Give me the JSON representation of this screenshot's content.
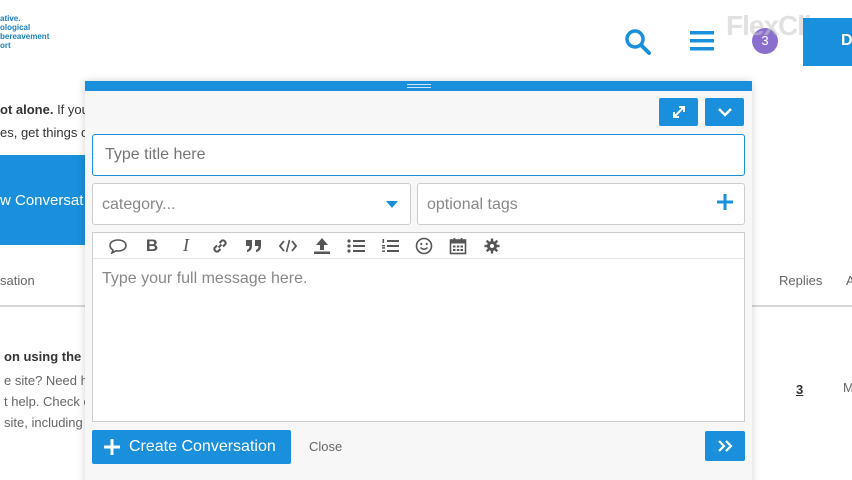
{
  "header": {
    "logo_lines": [
      "ative.",
      "ological",
      "bereavement",
      "ort"
    ],
    "avatar_initial": "3",
    "watermark": "FlexClip",
    "button_label": "D"
  },
  "background": {
    "intro_bold": "ot alone.",
    "intro_rest": " If you",
    "intro_line2": "es, get things o",
    "new_conversation": "w Conversat",
    "col_conversation": "sation",
    "col_replies": "Replies",
    "col_a": "A",
    "thread_title": "on using the",
    "thread_line1": "e site? Need h",
    "thread_line2": "t help. Check o",
    "thread_line3": "site, including",
    "reply_count": "3",
    "last_col": "M"
  },
  "modal": {
    "title_placeholder": "Type title here",
    "category_placeholder": "category...",
    "tags_placeholder": "optional tags",
    "message_placeholder": "Type your full message here.",
    "create_label": "Create Conversation",
    "close_label": "Close"
  },
  "colors": {
    "accent": "#1a8fdc"
  }
}
